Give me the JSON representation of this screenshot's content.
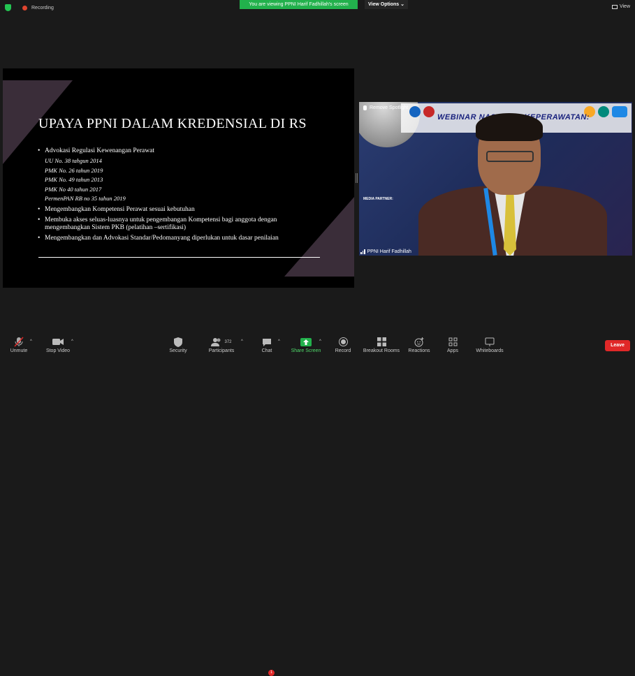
{
  "top": {
    "recording_label": "Recording",
    "viewing_banner": "You are viewing PPNI Harif Fadhillah's screen",
    "view_options": "View Options",
    "view_button": "View"
  },
  "slide": {
    "title": "UPAYA PPNI DALAM KREDENSIAL DI RS",
    "bullet1": "Advokasi Regulasi Kewenangan Perawat",
    "refs": [
      "UU No. 38 tahgun 2014",
      "PMK No. 26 tahun 2019",
      "PMK No. 49 tahun 2013",
      "PMK No 40 tahun 2017",
      "PermenPAN RB no 35 tahun 2019"
    ],
    "bullet2": "Mengembangkan Kompetensi Perawat sesuai kebutuhan",
    "bullet3_line1": "Membuka akses seluas-luasnya untuk pengembangan Kompetensi bagi anggota dengan",
    "bullet3_line2": "mengembangkan Sistem PKB (pelatihan –sertifikasi)",
    "bullet4": "Mengembangkan dan Advokasi Standar/Pedomanyang diperlukan untuk dasar penilaian"
  },
  "video": {
    "remove_spotlight": "Remove Spotlight",
    "banner_text": "WEBINAR NASIONAL KEPERAWATAN:",
    "media_partner": "MEDIA PARTNER:",
    "participant_name": "PPNI Harif Fadhillah"
  },
  "toolbar": {
    "unmute": "Unmute",
    "stop_video": "Stop Video",
    "security": "Security",
    "participants": "Participants",
    "participants_count": "372",
    "chat": "Chat",
    "chat_badge": "1",
    "share_screen": "Share Screen",
    "record": "Record",
    "breakout_rooms": "Breakout Rooms",
    "reactions": "Reactions",
    "apps": "Apps",
    "whiteboards": "Whiteboards",
    "leave": "Leave"
  },
  "colors": {
    "share_green": "#22b14c",
    "leave_red": "#e02828",
    "slide_accent": "#3a2d39"
  }
}
